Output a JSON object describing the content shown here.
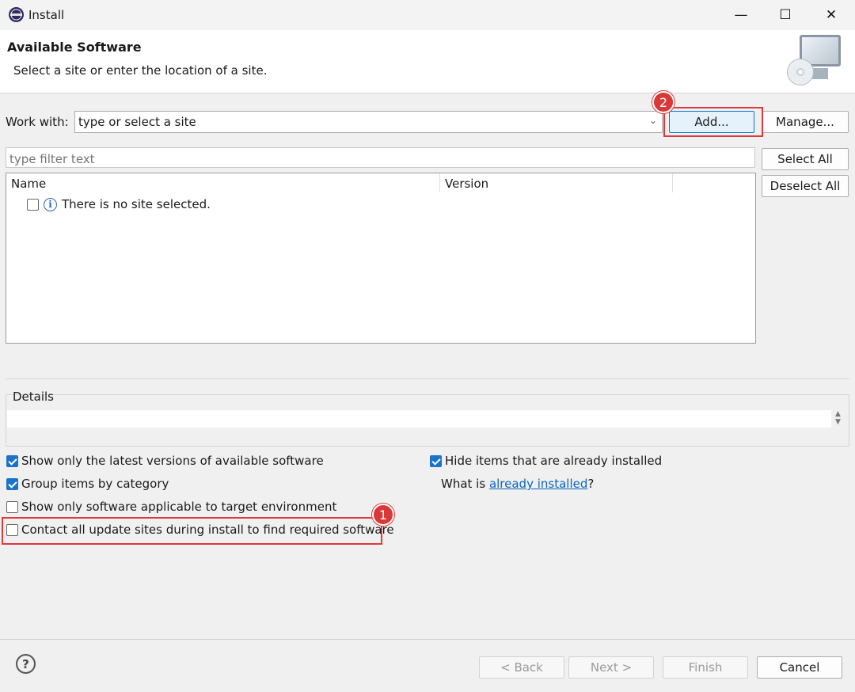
{
  "window": {
    "title": "Install",
    "minimize": "—",
    "maximize": "☐",
    "close": "✕"
  },
  "header": {
    "title": "Available Software",
    "subtitle": "Select a site or enter the location of a site."
  },
  "work_with": {
    "label": "Work with:",
    "value": "type or select a site",
    "arrow": "⌄",
    "add_label": "Add...",
    "manage_label": "Manage..."
  },
  "filter": {
    "placeholder": "type filter text"
  },
  "actions": {
    "select_all": "Select All",
    "deselect_all": "Deselect All"
  },
  "table": {
    "columns": [
      "Name",
      "Version"
    ],
    "rows": [
      {
        "name": "There is no site selected.",
        "checked": false
      }
    ]
  },
  "details": {
    "label": "Details",
    "arrows": "▲▼"
  },
  "options": {
    "latest_versions": {
      "label": "Show only the latest versions of available software",
      "checked": true
    },
    "group_by_category": {
      "label": "Group items by category",
      "checked": true
    },
    "target_env": {
      "label": "Show only software applicable to target environment",
      "checked": false
    },
    "contact_sites": {
      "label": "Contact all update sites during install to find required software",
      "checked": false
    },
    "hide_installed": {
      "label": "Hide items that are already installed",
      "checked": true
    },
    "what_is_prefix": "What is ",
    "what_is_link": "already installed",
    "what_is_suffix": "?"
  },
  "callouts": {
    "one": "1",
    "two": "2"
  },
  "footer": {
    "help": "?",
    "back": "< Back",
    "next": "Next >",
    "finish": "Finish",
    "cancel": "Cancel"
  },
  "colors": {
    "accent": "#0078d7",
    "callout_red": "#e0393a",
    "link": "#0a66c2"
  }
}
